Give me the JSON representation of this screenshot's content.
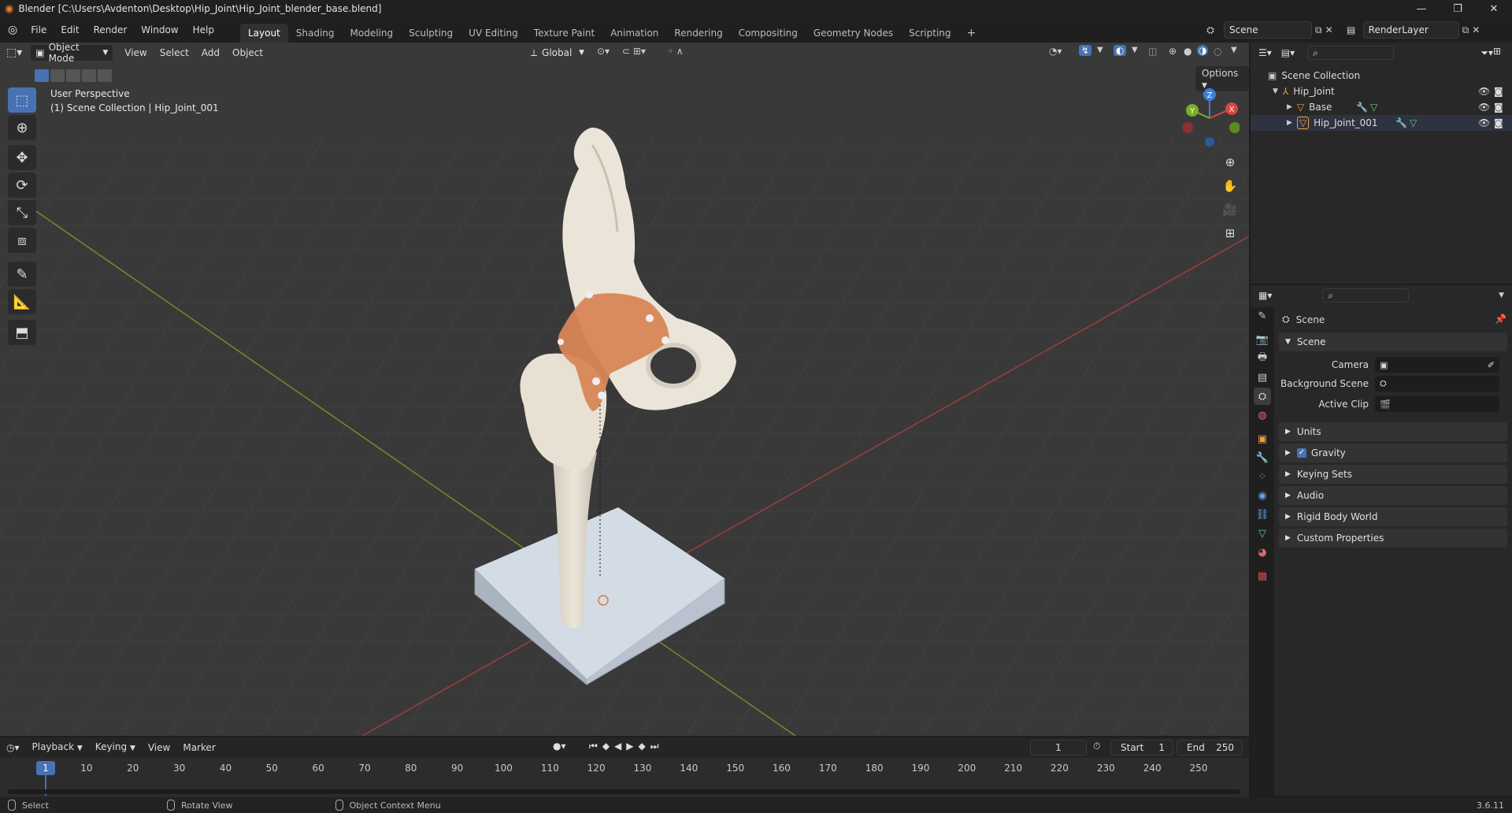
{
  "titlebar": {
    "title": "Blender [C:\\Users\\Avdenton\\Desktop\\Hip_Joint\\Hip_Joint_blender_base.blend]",
    "minimize": "—",
    "restore": "❐",
    "close": "✕"
  },
  "menu": [
    "File",
    "Edit",
    "Render",
    "Window",
    "Help"
  ],
  "workspace_tabs": [
    "Layout",
    "Shading",
    "Modeling",
    "Sculpting",
    "UV Editing",
    "Texture Paint",
    "Animation",
    "Rendering",
    "Compositing",
    "Geometry Nodes",
    "Scripting"
  ],
  "active_workspace": "Layout",
  "add_workspace": "+",
  "scene_field": "Scene",
  "view_layer_field": "RenderLayer",
  "viewport": {
    "mode": "Object Mode",
    "menus": [
      "View",
      "Select",
      "Add",
      "Object"
    ],
    "orientation": "Global",
    "options_label": "Options",
    "info_line1": "User Perspective",
    "info_line2": "(1) Scene Collection | Hip_Joint_001",
    "gizmo_x": "X",
    "gizmo_y": "Y",
    "gizmo_z": "Z",
    "colors": {
      "background": "#3a3a3a",
      "grid": "#444444",
      "x_axis": "#a13a3a",
      "y_axis": "#6d8f25",
      "bone": "#e0d9cc",
      "implant": "#d88658",
      "base": "#c8d1dc"
    }
  },
  "outliner": {
    "root": "Scene Collection",
    "collection": "Hip_Joint",
    "items": [
      "Base",
      "Hip_Joint_001"
    ]
  },
  "properties": {
    "context_title": "Scene",
    "scene_panel": "Scene",
    "camera_label": "Camera",
    "background_scene_label": "Background Scene",
    "active_clip_label": "Active Clip",
    "collapsed_panels": [
      "Units",
      "Gravity",
      "Keying Sets",
      "Audio",
      "Rigid Body World",
      "Custom Properties"
    ],
    "gravity_checked": true
  },
  "timeline": {
    "menus": [
      "Playback",
      "Keying",
      "View",
      "Marker"
    ],
    "current_frame": "1",
    "start_label": "Start",
    "start_value": "1",
    "end_label": "End",
    "end_value": "250",
    "ruler": [
      "1",
      "10",
      "20",
      "30",
      "40",
      "50",
      "60",
      "70",
      "80",
      "90",
      "100",
      "110",
      "120",
      "130",
      "140",
      "150",
      "160",
      "170",
      "180",
      "190",
      "200",
      "210",
      "220",
      "230",
      "240",
      "250"
    ]
  },
  "statusbar": {
    "select": "Select",
    "rotate": "Rotate View",
    "context_menu": "Object Context Menu",
    "version": "3.6.11"
  }
}
